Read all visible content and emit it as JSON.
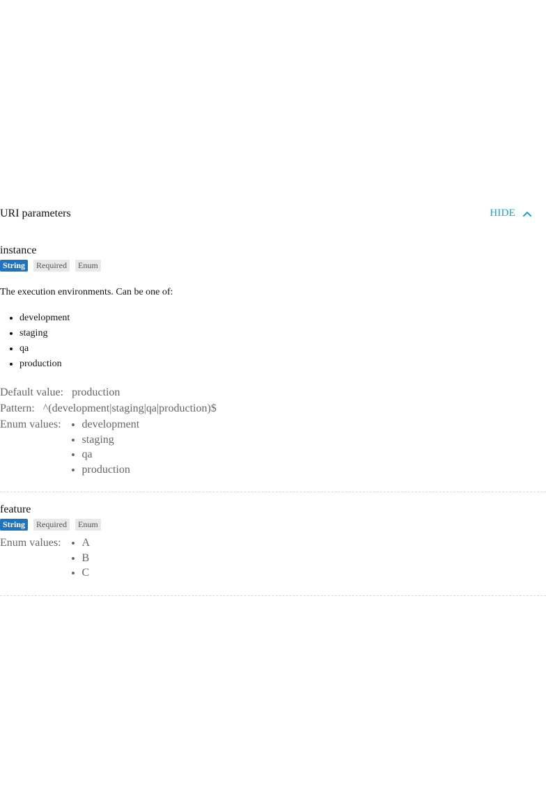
{
  "section": {
    "title": "URI parameters",
    "toggle_label": "HIDE",
    "toggle_icon": "chevron-up-icon",
    "accent_color": "#1aa1d8"
  },
  "params": [
    {
      "name": "instance",
      "badges": {
        "type": "String",
        "required": "Required",
        "enum": "Enum"
      },
      "description": "The execution environments. Can be one of:",
      "description_list": [
        "development",
        "staging",
        "qa",
        "production"
      ],
      "default_label": "Default value:",
      "default_value": "production",
      "pattern_label": "Pattern:",
      "pattern_value": "^(development|staging|qa|production)$",
      "enum_label": "Enum values:",
      "enum_values": [
        "development",
        "staging",
        "qa",
        "production"
      ]
    },
    {
      "name": "feature",
      "badges": {
        "type": "String",
        "required": "Required",
        "enum": "Enum"
      },
      "enum_label": "Enum values:",
      "enum_values": [
        "A",
        "B",
        "C"
      ]
    }
  ],
  "colors": {
    "type_badge": "#1e73be",
    "tag_badge": "#e8e8e8",
    "divider": "#d8d8d8"
  }
}
